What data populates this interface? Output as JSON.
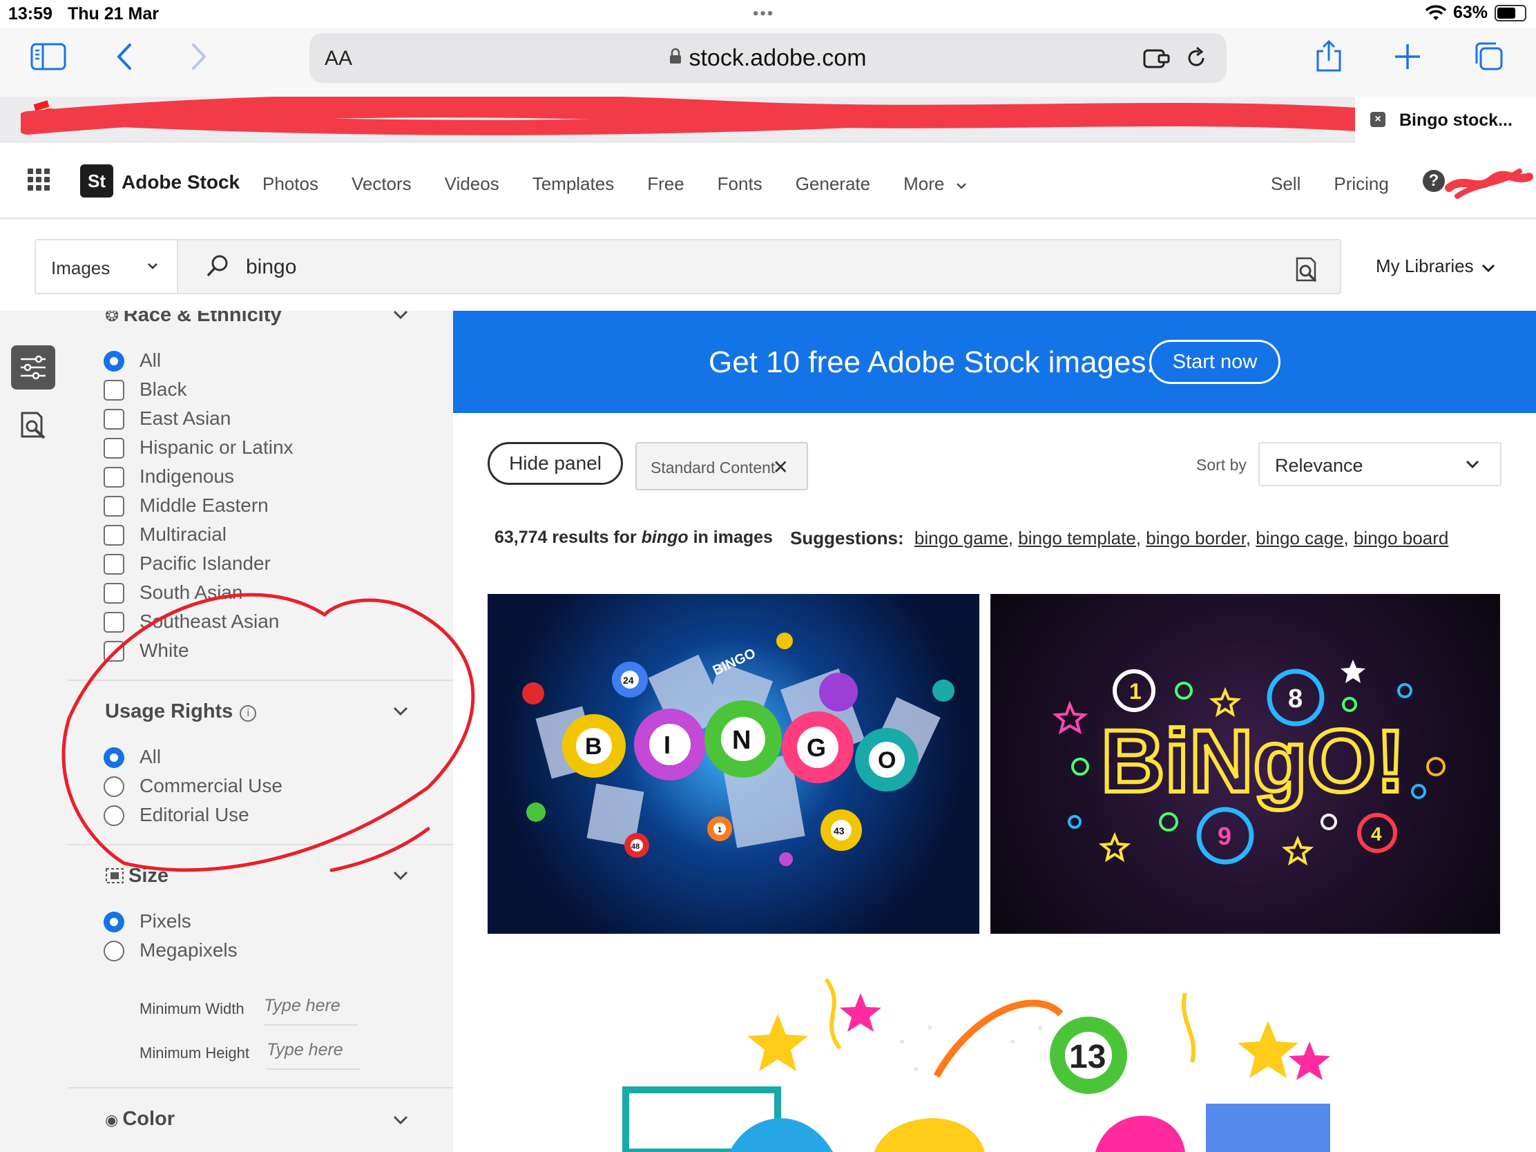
{
  "status_bar": {
    "time": "13:59",
    "date": "Thu 21 Mar",
    "battery": "63%"
  },
  "browser": {
    "aa_label": "AA",
    "url": "stock.adobe.com",
    "active_tab_title": "Bingo stock..."
  },
  "stock_nav": {
    "logo_text": "St",
    "brand": "Adobe Stock",
    "links": [
      "Photos",
      "Vectors",
      "Videos",
      "Templates",
      "Free",
      "Fonts",
      "Generate",
      "More"
    ],
    "right_links": [
      "Sell",
      "Pricing"
    ]
  },
  "search": {
    "type": "Images",
    "query": "bingo",
    "libraries_label": "My Libraries"
  },
  "filters": {
    "race": {
      "title": "Race & Ethnicity",
      "options": [
        "All",
        "Black",
        "East Asian",
        "Hispanic or Latinx",
        "Indigenous",
        "Middle Eastern",
        "Multiracial",
        "Pacific Islander",
        "South Asian",
        "Southeast Asian",
        "White"
      ],
      "selected": "All"
    },
    "usage": {
      "title": "Usage Rights",
      "info": "i",
      "options": [
        "All",
        "Commercial Use",
        "Editorial Use"
      ],
      "selected": "All"
    },
    "size": {
      "title": "Size",
      "options": [
        "Pixels",
        "Megapixels"
      ],
      "selected": "Pixels",
      "min_width_label": "Minimum Width",
      "min_height_label": "Minimum Height",
      "placeholder": "Type here"
    },
    "color": {
      "title": "Color"
    }
  },
  "promo": {
    "text": "Get 10 free Adobe Stock images.",
    "button": "Start now"
  },
  "toolbar": {
    "hide_panel": "Hide panel",
    "chip": "Standard Content",
    "sort_label": "Sort by",
    "sort_value": "Relevance"
  },
  "results": {
    "count": "63,774 results for",
    "query": "bingo",
    "suffix": "in images",
    "suggestions_label": "Suggestions:",
    "suggestions": [
      "bingo game",
      "bingo template",
      "bingo border",
      "bingo cage",
      "bingo board"
    ]
  },
  "thumbs": {
    "t1_letters": [
      "B",
      "I",
      "N",
      "G",
      "O"
    ],
    "t1_ball_numbers": [
      "24",
      "48",
      "43",
      "1"
    ],
    "t1_card_label": "BINGO",
    "t2_text": "BiNgO!",
    "t2_numbers": [
      "1",
      "8",
      "9",
      "4"
    ],
    "t3_number": "13"
  },
  "colors": {
    "accent": "#1473e6",
    "annotation": "#e8202a"
  }
}
